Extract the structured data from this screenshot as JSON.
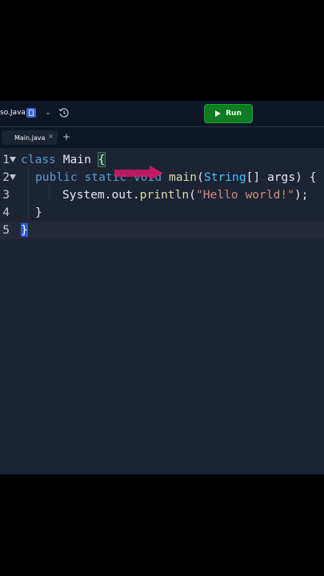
{
  "topbar": {
    "repl_name": "so.Java",
    "run_label": "Run"
  },
  "tabs": {
    "items": [
      {
        "label": "Main.java",
        "close": "×"
      }
    ],
    "add": "+"
  },
  "editor": {
    "line_numbers": [
      "1",
      "2",
      "3",
      "4",
      "5"
    ],
    "lines": [
      "class Main {",
      "public static void main(String[] args) {",
      "System.out.println(\"Hello world!\");",
      "}",
      "}"
    ]
  },
  "colors": {
    "run_button": "#0f7b24",
    "annotation_arrow": "#d6186b",
    "editor_bg": "#1c2333"
  },
  "icons": [
    "java-file-icon",
    "chevron-down-icon",
    "history-icon",
    "play-icon",
    "close-icon",
    "plus-icon",
    "fold-arrow-icon",
    "arrow-annotation-icon"
  ]
}
